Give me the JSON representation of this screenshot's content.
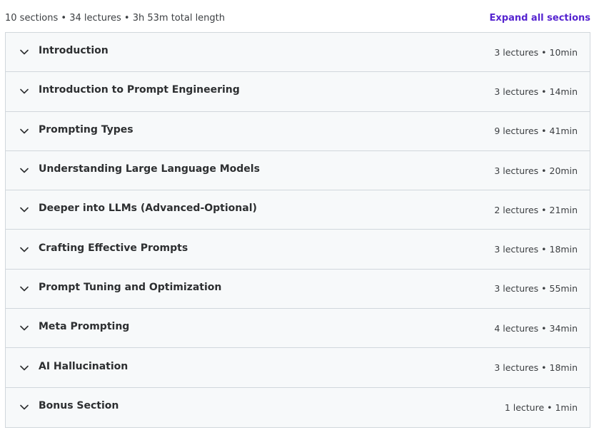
{
  "summary": {
    "text": "10 sections • 34 lectures • 3h 53m total length",
    "expand_label": "Expand all sections"
  },
  "colors": {
    "accent": "#5624d0",
    "row_bg": "#f7f9fa",
    "border": "#d1d7dc"
  },
  "sections": [
    {
      "title": "Introduction",
      "meta": "3 lectures • 10min",
      "icon": "chevron-down-icon"
    },
    {
      "title": "Introduction to Prompt Engineering",
      "meta": "3 lectures • 14min",
      "icon": "chevron-down-icon"
    },
    {
      "title": "Prompting Types",
      "meta": "9 lectures • 41min",
      "icon": "chevron-down-icon"
    },
    {
      "title": "Understanding Large Language Models",
      "meta": "3 lectures • 20min",
      "icon": "chevron-down-icon"
    },
    {
      "title": "Deeper into LLMs (Advanced-Optional)",
      "meta": "2 lectures • 21min",
      "icon": "chevron-down-icon"
    },
    {
      "title": "Crafting Effective Prompts",
      "meta": "3 lectures • 18min",
      "icon": "chevron-down-icon"
    },
    {
      "title": "Prompt Tuning and Optimization",
      "meta": "3 lectures • 55min",
      "icon": "chevron-down-icon"
    },
    {
      "title": "Meta Prompting",
      "meta": "4 lectures • 34min",
      "icon": "chevron-down-icon"
    },
    {
      "title": "AI Hallucination",
      "meta": "3 lectures • 18min",
      "icon": "chevron-down-icon"
    },
    {
      "title": "Bonus Section",
      "meta": "1 lecture • 1min",
      "icon": "chevron-down-icon"
    }
  ]
}
